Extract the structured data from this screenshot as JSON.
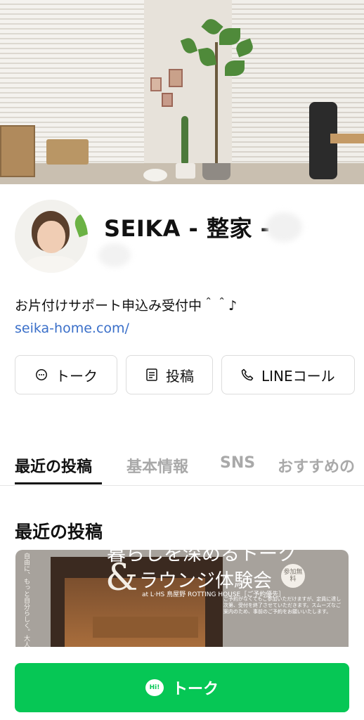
{
  "profile": {
    "name": "SEIKA - 整家 -",
    "status": "お片付けサポート申込み受付中＾＾♪",
    "link": "seika-home.com/"
  },
  "actions": {
    "talk_label": "トーク",
    "post_label": "投稿",
    "call_label": "LINEコール"
  },
  "tabs": [
    {
      "label": "最近の投稿",
      "active": true
    },
    {
      "label": "基本情報",
      "active": false
    },
    {
      "label": "SNS",
      "active": false
    },
    {
      "label": "おすすめの",
      "active": false
    }
  ],
  "section": {
    "title": "最近の投稿"
  },
  "post": {
    "top_text": "暮らしを深めるトーク",
    "amp": "&",
    "headline": "ラウンジ体験会",
    "badge": "参加無料",
    "sub": "at L·HS 鳥屋野 ROTTING HOUSE［ご予約優先］",
    "vertical_text": "自由に、もっと自分らしく。大人のための、小さなトークイベント。",
    "small_text": "ご予約がなくてもご参加いただけますが、定員に達し次第、受付を終了させていただきます。スムーズなご案内のため、事前のご予約をお願いいたします。"
  },
  "cta": {
    "icon_label": "Hi!",
    "label": "トーク"
  },
  "colors": {
    "line_green": "#06c755",
    "link_blue": "#3a6fc9"
  },
  "icons": [
    "chat-bubble-icon",
    "post-icon",
    "phone-icon",
    "line-chat-icon"
  ]
}
